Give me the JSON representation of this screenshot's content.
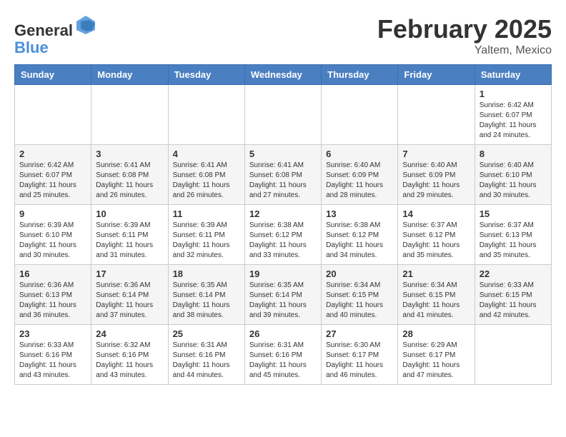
{
  "header": {
    "logo_line1": "General",
    "logo_line2": "Blue",
    "month_title": "February 2025",
    "location": "Yaltem, Mexico"
  },
  "weekdays": [
    "Sunday",
    "Monday",
    "Tuesday",
    "Wednesday",
    "Thursday",
    "Friday",
    "Saturday"
  ],
  "weeks": [
    [
      {
        "day": "",
        "info": ""
      },
      {
        "day": "",
        "info": ""
      },
      {
        "day": "",
        "info": ""
      },
      {
        "day": "",
        "info": ""
      },
      {
        "day": "",
        "info": ""
      },
      {
        "day": "",
        "info": ""
      },
      {
        "day": "1",
        "info": "Sunrise: 6:42 AM\nSunset: 6:07 PM\nDaylight: 11 hours\nand 24 minutes."
      }
    ],
    [
      {
        "day": "2",
        "info": "Sunrise: 6:42 AM\nSunset: 6:07 PM\nDaylight: 11 hours\nand 25 minutes."
      },
      {
        "day": "3",
        "info": "Sunrise: 6:41 AM\nSunset: 6:08 PM\nDaylight: 11 hours\nand 26 minutes."
      },
      {
        "day": "4",
        "info": "Sunrise: 6:41 AM\nSunset: 6:08 PM\nDaylight: 11 hours\nand 26 minutes."
      },
      {
        "day": "5",
        "info": "Sunrise: 6:41 AM\nSunset: 6:08 PM\nDaylight: 11 hours\nand 27 minutes."
      },
      {
        "day": "6",
        "info": "Sunrise: 6:40 AM\nSunset: 6:09 PM\nDaylight: 11 hours\nand 28 minutes."
      },
      {
        "day": "7",
        "info": "Sunrise: 6:40 AM\nSunset: 6:09 PM\nDaylight: 11 hours\nand 29 minutes."
      },
      {
        "day": "8",
        "info": "Sunrise: 6:40 AM\nSunset: 6:10 PM\nDaylight: 11 hours\nand 30 minutes."
      }
    ],
    [
      {
        "day": "9",
        "info": "Sunrise: 6:39 AM\nSunset: 6:10 PM\nDaylight: 11 hours\nand 30 minutes."
      },
      {
        "day": "10",
        "info": "Sunrise: 6:39 AM\nSunset: 6:11 PM\nDaylight: 11 hours\nand 31 minutes."
      },
      {
        "day": "11",
        "info": "Sunrise: 6:39 AM\nSunset: 6:11 PM\nDaylight: 11 hours\nand 32 minutes."
      },
      {
        "day": "12",
        "info": "Sunrise: 6:38 AM\nSunset: 6:12 PM\nDaylight: 11 hours\nand 33 minutes."
      },
      {
        "day": "13",
        "info": "Sunrise: 6:38 AM\nSunset: 6:12 PM\nDaylight: 11 hours\nand 34 minutes."
      },
      {
        "day": "14",
        "info": "Sunrise: 6:37 AM\nSunset: 6:12 PM\nDaylight: 11 hours\nand 35 minutes."
      },
      {
        "day": "15",
        "info": "Sunrise: 6:37 AM\nSunset: 6:13 PM\nDaylight: 11 hours\nand 35 minutes."
      }
    ],
    [
      {
        "day": "16",
        "info": "Sunrise: 6:36 AM\nSunset: 6:13 PM\nDaylight: 11 hours\nand 36 minutes."
      },
      {
        "day": "17",
        "info": "Sunrise: 6:36 AM\nSunset: 6:14 PM\nDaylight: 11 hours\nand 37 minutes."
      },
      {
        "day": "18",
        "info": "Sunrise: 6:35 AM\nSunset: 6:14 PM\nDaylight: 11 hours\nand 38 minutes."
      },
      {
        "day": "19",
        "info": "Sunrise: 6:35 AM\nSunset: 6:14 PM\nDaylight: 11 hours\nand 39 minutes."
      },
      {
        "day": "20",
        "info": "Sunrise: 6:34 AM\nSunset: 6:15 PM\nDaylight: 11 hours\nand 40 minutes."
      },
      {
        "day": "21",
        "info": "Sunrise: 6:34 AM\nSunset: 6:15 PM\nDaylight: 11 hours\nand 41 minutes."
      },
      {
        "day": "22",
        "info": "Sunrise: 6:33 AM\nSunset: 6:15 PM\nDaylight: 11 hours\nand 42 minutes."
      }
    ],
    [
      {
        "day": "23",
        "info": "Sunrise: 6:33 AM\nSunset: 6:16 PM\nDaylight: 11 hours\nand 43 minutes."
      },
      {
        "day": "24",
        "info": "Sunrise: 6:32 AM\nSunset: 6:16 PM\nDaylight: 11 hours\nand 43 minutes."
      },
      {
        "day": "25",
        "info": "Sunrise: 6:31 AM\nSunset: 6:16 PM\nDaylight: 11 hours\nand 44 minutes."
      },
      {
        "day": "26",
        "info": "Sunrise: 6:31 AM\nSunset: 6:16 PM\nDaylight: 11 hours\nand 45 minutes."
      },
      {
        "day": "27",
        "info": "Sunrise: 6:30 AM\nSunset: 6:17 PM\nDaylight: 11 hours\nand 46 minutes."
      },
      {
        "day": "28",
        "info": "Sunrise: 6:29 AM\nSunset: 6:17 PM\nDaylight: 11 hours\nand 47 minutes."
      },
      {
        "day": "",
        "info": ""
      }
    ]
  ]
}
